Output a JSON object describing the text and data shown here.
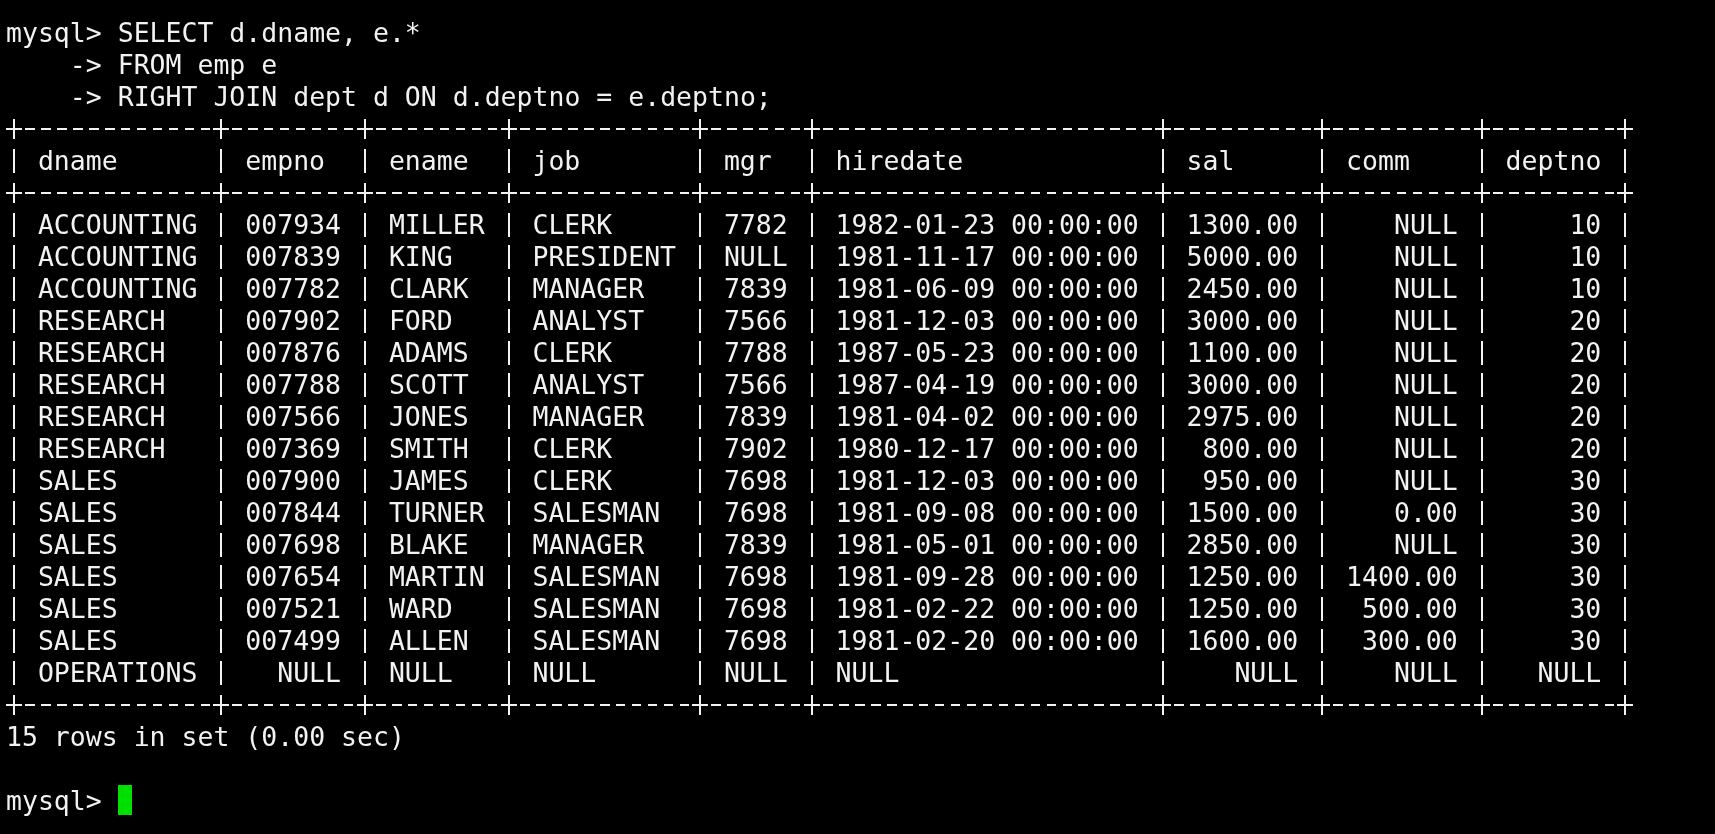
{
  "command_lines": [
    "mysql> SELECT d.dname, e.*",
    "    -> FROM emp e",
    "    -> RIGHT JOIN dept d ON d.deptno = e.deptno;"
  ],
  "table": {
    "columns": [
      {
        "name": "dname",
        "right_aligned": false
      },
      {
        "name": "empno",
        "right_aligned": true
      },
      {
        "name": "ename",
        "right_aligned": false
      },
      {
        "name": "job",
        "right_aligned": false
      },
      {
        "name": "mgr"
      },
      {
        "name": "hiredate",
        "right_aligned": false
      },
      {
        "name": "sal",
        "right_aligned": true
      },
      {
        "name": "comm",
        "right_aligned": true
      },
      {
        "name": "deptno",
        "right_aligned": true
      }
    ],
    "rows": [
      [
        "ACCOUNTING",
        "007934",
        "MILLER",
        "CLERK",
        "7782",
        "1982-01-23 00:00:00",
        "1300.00",
        "NULL",
        "10"
      ],
      [
        "ACCOUNTING",
        "007839",
        "KING",
        "PRESIDENT",
        "NULL",
        "1981-11-17 00:00:00",
        "5000.00",
        "NULL",
        "10"
      ],
      [
        "ACCOUNTING",
        "007782",
        "CLARK",
        "MANAGER",
        "7839",
        "1981-06-09 00:00:00",
        "2450.00",
        "NULL",
        "10"
      ],
      [
        "RESEARCH",
        "007902",
        "FORD",
        "ANALYST",
        "7566",
        "1981-12-03 00:00:00",
        "3000.00",
        "NULL",
        "20"
      ],
      [
        "RESEARCH",
        "007876",
        "ADAMS",
        "CLERK",
        "7788",
        "1987-05-23 00:00:00",
        "1100.00",
        "NULL",
        "20"
      ],
      [
        "RESEARCH",
        "007788",
        "SCOTT",
        "ANALYST",
        "7566",
        "1987-04-19 00:00:00",
        "3000.00",
        "NULL",
        "20"
      ],
      [
        "RESEARCH",
        "007566",
        "JONES",
        "MANAGER",
        "7839",
        "1981-04-02 00:00:00",
        "2975.00",
        "NULL",
        "20"
      ],
      [
        "RESEARCH",
        "007369",
        "SMITH",
        "CLERK",
        "7902",
        "1980-12-17 00:00:00",
        "800.00",
        "NULL",
        "20"
      ],
      [
        "SALES",
        "007900",
        "JAMES",
        "CLERK",
        "7698",
        "1981-12-03 00:00:00",
        "950.00",
        "NULL",
        "30"
      ],
      [
        "SALES",
        "007844",
        "TURNER",
        "SALESMAN",
        "7698",
        "1981-09-08 00:00:00",
        "1500.00",
        "0.00",
        "30"
      ],
      [
        "SALES",
        "007698",
        "BLAKE",
        "MANAGER",
        "7839",
        "1981-05-01 00:00:00",
        "2850.00",
        "NULL",
        "30"
      ],
      [
        "SALES",
        "007654",
        "MARTIN",
        "SALESMAN",
        "7698",
        "1981-09-28 00:00:00",
        "1250.00",
        "1400.00",
        "30"
      ],
      [
        "SALES",
        "007521",
        "WARD",
        "SALESMAN",
        "7698",
        "1981-02-22 00:00:00",
        "1250.00",
        "500.00",
        "30"
      ],
      [
        "SALES",
        "007499",
        "ALLEN",
        "SALESMAN",
        "7698",
        "1981-02-20 00:00:00",
        "1600.00",
        "300.00",
        "30"
      ],
      [
        "OPERATIONS",
        "NULL",
        "NULL",
        "NULL",
        "NULL",
        "NULL",
        "NULL",
        "NULL",
        "NULL"
      ]
    ]
  },
  "result_summary": "15 rows in set (0.00 sec)",
  "prompt": {
    "text": "mysql>",
    "cursor_visible": true
  }
}
